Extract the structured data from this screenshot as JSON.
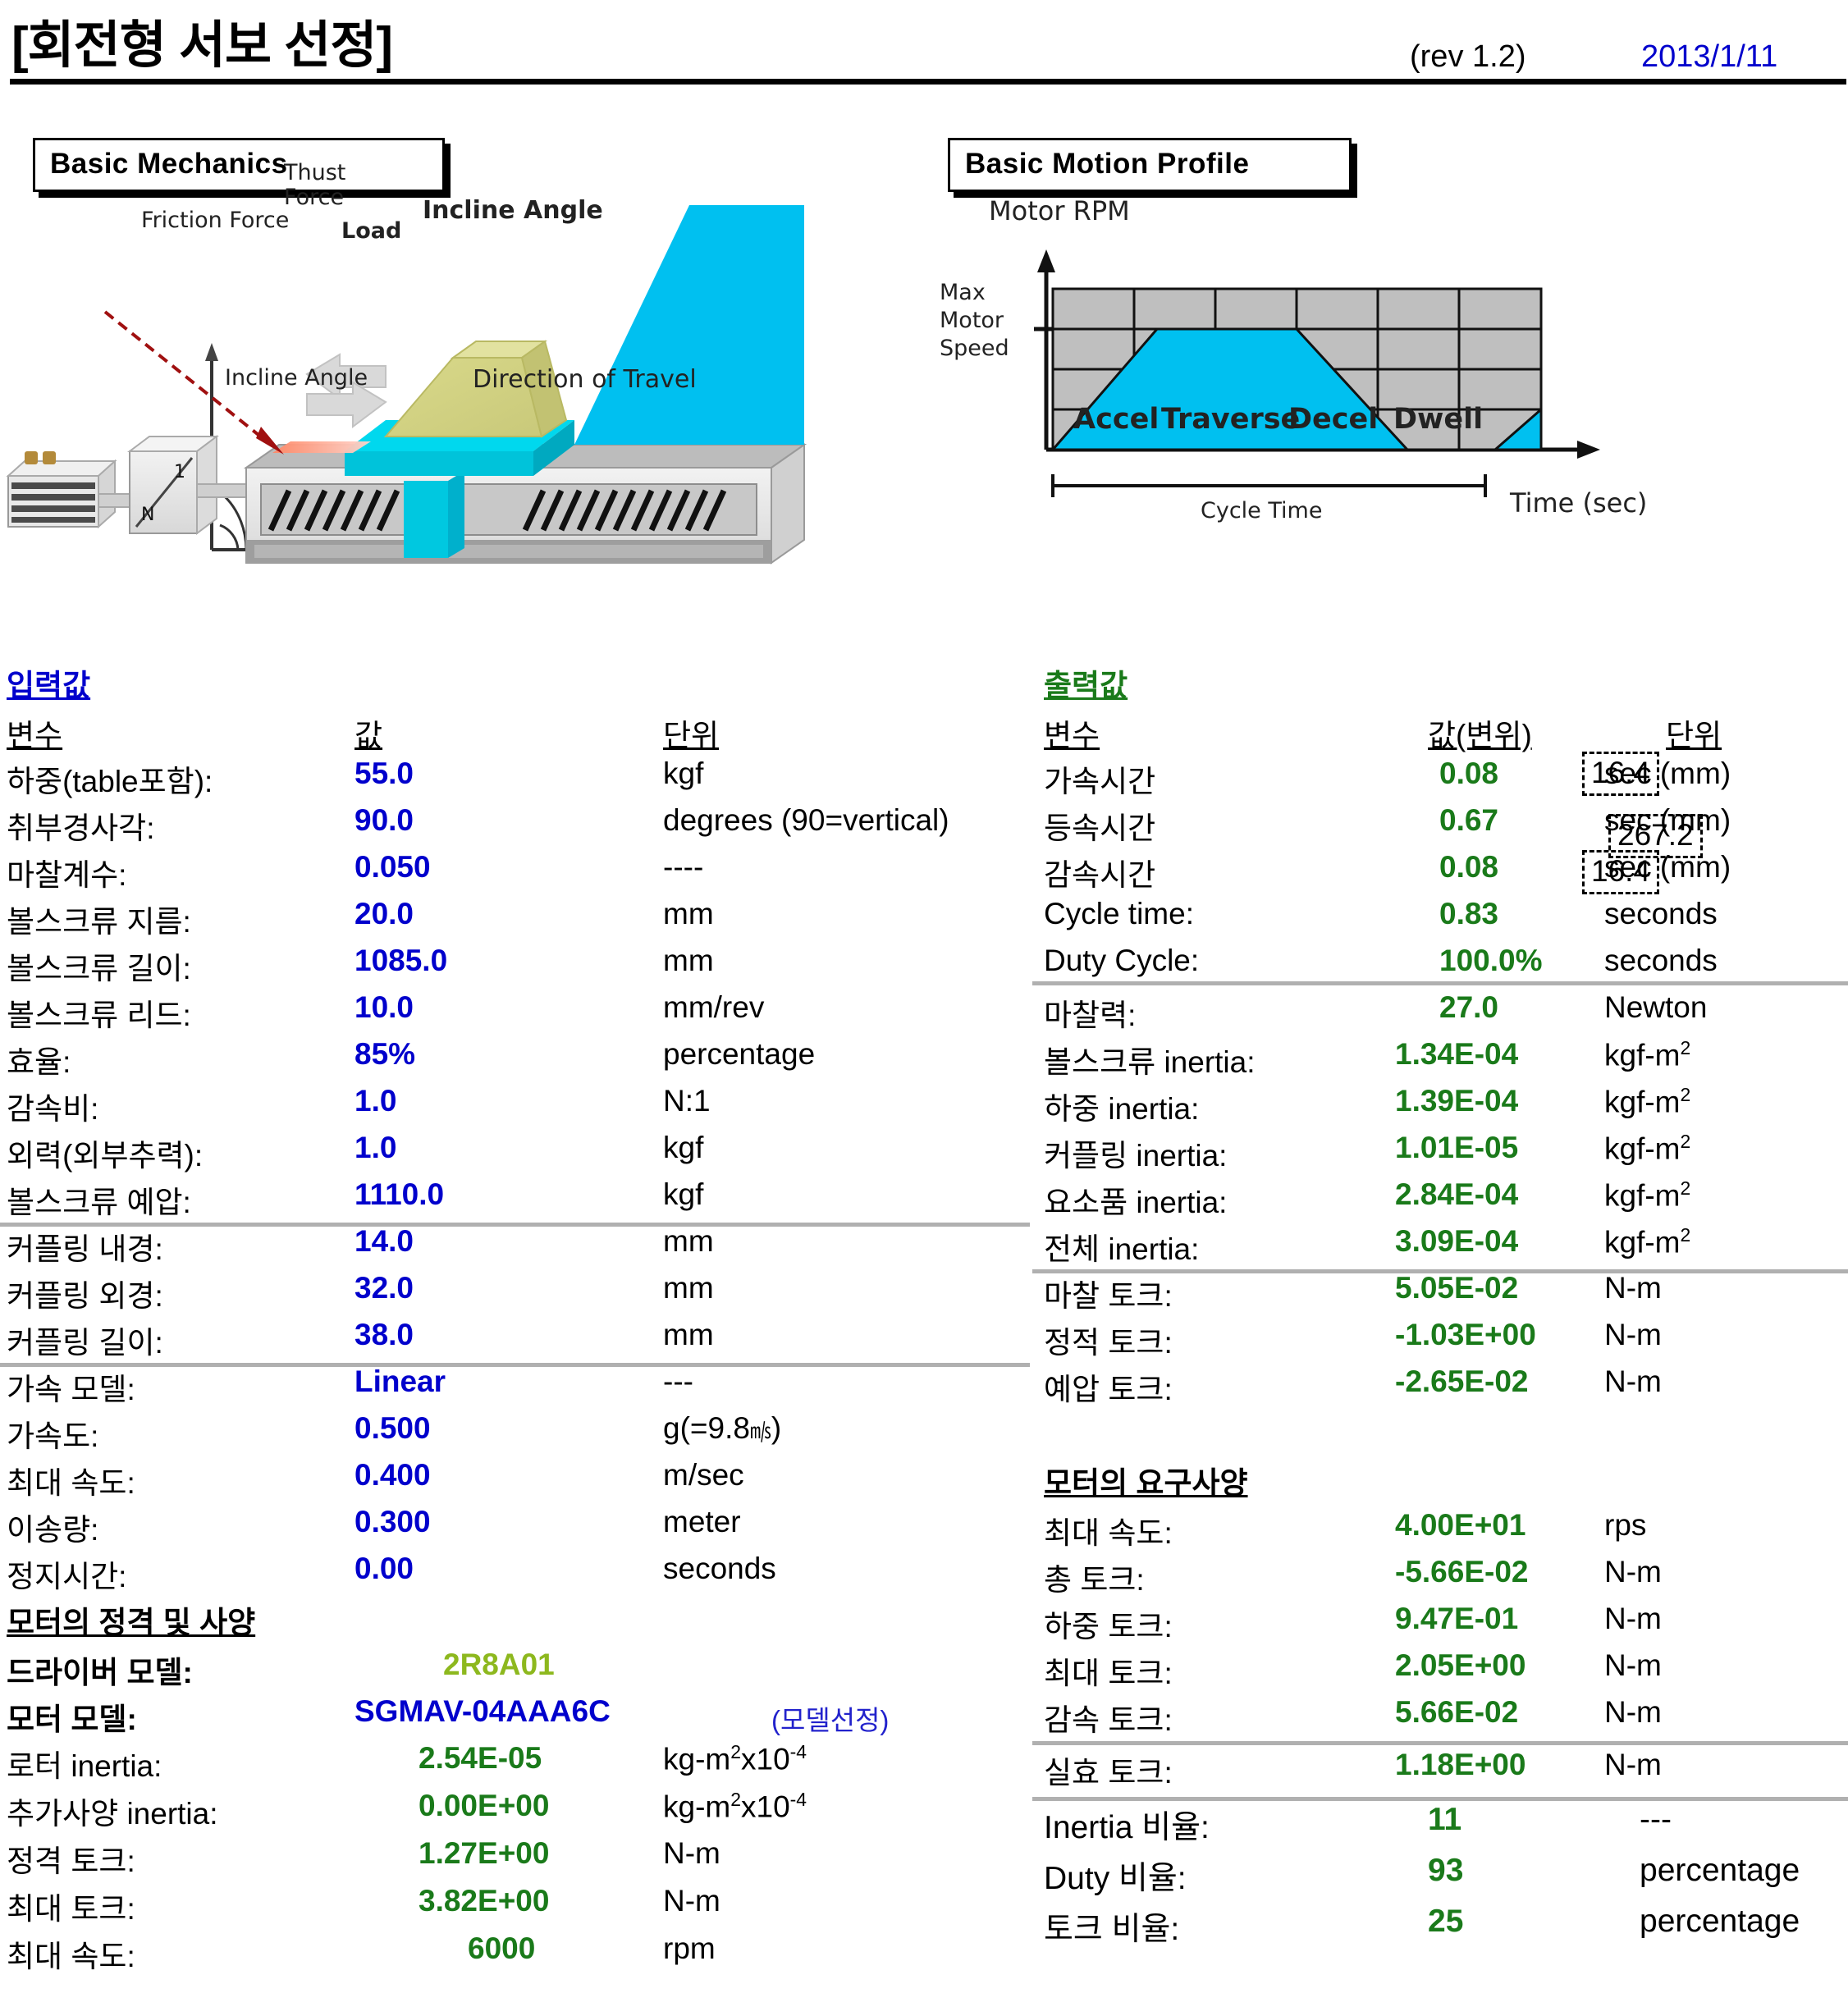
{
  "header": {
    "title": "[회전형 서보 선정]",
    "revision": "(rev 1.2)",
    "date": "2013/1/11"
  },
  "panels": {
    "mechanics_title": "Basic Mechanics",
    "motion_title": "Basic Motion Profile"
  },
  "mechanics_diagram": {
    "labels": {
      "thrust_force": "Thust\nForce",
      "thrust_force_l1": "Thust",
      "thrust_force_l2": "Force",
      "friction_force": "Friction Force",
      "load": "Load",
      "incline_angle_top": "Incline Angle",
      "incline_angle_bottom": "Incline Angle",
      "direction_of_travel": "Direction of Travel",
      "gear_n": "N",
      "gear_1": "1"
    }
  },
  "chart_data": {
    "type": "area",
    "title": "Basic Motion Profile",
    "xlabel": "Time (sec)",
    "ylabel": "Motor RPM",
    "y_tick_label": "Max\nMotor\nSpeed",
    "y_tick_l1": "Max",
    "y_tick_l2": "Motor",
    "y_tick_l3": "Speed",
    "span_label": "Cycle Time",
    "segments": [
      {
        "name": "Accel",
        "t_start": 0.0,
        "t_end": 0.22,
        "rpm_start": 0.0,
        "rpm_end": 1.0
      },
      {
        "name": "Traverse",
        "t_start": 0.22,
        "t_end": 0.5,
        "rpm_start": 1.0,
        "rpm_end": 1.0
      },
      {
        "name": "Decel",
        "t_start": 0.5,
        "t_end": 0.73,
        "rpm_start": 1.0,
        "rpm_end": 0.0
      },
      {
        "name": "Dwell",
        "t_start": 0.73,
        "t_end": 0.88,
        "rpm_start": 0.0,
        "rpm_end": 0.0
      }
    ],
    "x": [
      0.0,
      0.22,
      0.5,
      0.73,
      0.88,
      0.91,
      1.0
    ],
    "y": [
      0.0,
      1.0,
      1.0,
      0.0,
      0.0,
      0.0,
      0.33
    ],
    "ylim": [
      0,
      1.33
    ],
    "xlim": [
      0,
      1.05
    ],
    "grid": true,
    "grid_fill": "#bfbfbf",
    "series_fill": "#00c0f0",
    "legend": "none"
  },
  "input_section": {
    "heading": "입력값",
    "columns": [
      "변수",
      "값",
      "단위"
    ],
    "rows": [
      {
        "label": "하중(table포함):",
        "value": "55.0",
        "unit": "kgf"
      },
      {
        "label": "취부경사각:",
        "value": "90.0",
        "unit": "degrees (90=vertical)"
      },
      {
        "label": "마찰계수:",
        "value": "0.050",
        "unit": "----"
      },
      {
        "label": "볼스크류 지름:",
        "value": "20.0",
        "unit": "mm"
      },
      {
        "label": "볼스크류 길이:",
        "value": "1085.0",
        "unit": "mm"
      },
      {
        "label": "볼스크류 리드:",
        "value": "10.0",
        "unit": "mm/rev"
      },
      {
        "label": "효율:",
        "value": "85%",
        "unit": "percentage"
      },
      {
        "label": "감속비:",
        "value": "1.0",
        "unit": "N:1"
      },
      {
        "label": "외력(외부추력):",
        "value": "1.0",
        "unit": "kgf"
      },
      {
        "label": "볼스크류 예압:",
        "value": "1110.0",
        "unit": "kgf"
      },
      {
        "label": "커플링 내경:",
        "value": "14.0",
        "unit": "mm"
      },
      {
        "label": "커플링 외경:",
        "value": "32.0",
        "unit": "mm"
      },
      {
        "label": "커플링 길이:",
        "value": "38.0",
        "unit": "mm"
      },
      {
        "label": "가속 모델:",
        "value": "Linear",
        "unit": "---"
      },
      {
        "label": "가속도:",
        "value": "0.500",
        "unit": "g(=9.8㎧)"
      },
      {
        "label": "최대 속도:",
        "value": "0.400",
        "unit": "m/sec"
      },
      {
        "label": "이송량:",
        "value": "0.300",
        "unit": "meter"
      },
      {
        "label": "정지시간:",
        "value": "0.00",
        "unit": "seconds"
      }
    ]
  },
  "motor_spec_section": {
    "heading": "모터의 정격 및 사양",
    "driver_model_label": "드라이버 모델:",
    "driver_model_value": "2R8A01",
    "motor_model_label": "모터 모델:",
    "motor_model_value": "SGMAV-04AAA6C",
    "motor_model_note": "(모델선정)",
    "rows": [
      {
        "label": "로터 inertia:",
        "value": "2.54E-05",
        "unit_base": "kg-m",
        "unit_sup": "2",
        "unit_tail": "x10",
        "unit_exp": "-4"
      },
      {
        "label": "추가사양 inertia:",
        "value": "0.00E+00",
        "unit_base": "kg-m",
        "unit_sup": "2",
        "unit_tail": "x10",
        "unit_exp": "-4"
      },
      {
        "label": "정격 토크:",
        "value": "1.27E+00",
        "unit_base": "N-m",
        "unit_sup": "",
        "unit_tail": "",
        "unit_exp": ""
      },
      {
        "label": "최대 토크:",
        "value": "3.82E+00",
        "unit_base": "N-m",
        "unit_sup": "",
        "unit_tail": "",
        "unit_exp": ""
      },
      {
        "label": "최대 속도:",
        "value": "6000",
        "unit_base": "rpm",
        "unit_sup": "",
        "unit_tail": "",
        "unit_exp": ""
      }
    ]
  },
  "output_section": {
    "heading": "출력값",
    "columns": [
      "변수",
      "값(변위)",
      "단위"
    ],
    "rows": [
      {
        "label": "가속시간",
        "value": "0.08",
        "unit": "sec (mm)"
      },
      {
        "label": "등속시간",
        "value": "0.67",
        "unit": "sec (mm)"
      },
      {
        "label": "감속시간",
        "value": "0.08",
        "unit": "sec (mm)"
      },
      {
        "label": "Cycle time:",
        "value": "0.83",
        "unit": "seconds"
      },
      {
        "label": "Duty Cycle:",
        "value": "100.0%",
        "unit": "seconds"
      },
      {
        "label": "마찰력:",
        "value": "27.0",
        "unit": "Newton"
      },
      {
        "label": "볼스크류 inertia:",
        "value": "1.34E-04",
        "unit_base": "kgf-m",
        "unit_sup": "2"
      },
      {
        "label": "하중 inertia:",
        "value": "1.39E-04",
        "unit_base": "kgf-m",
        "unit_sup": "2"
      },
      {
        "label": "커플링 inertia:",
        "value": "1.01E-05",
        "unit_base": "kgf-m",
        "unit_sup": "2"
      },
      {
        "label": "요소품 inertia:",
        "value": "2.84E-04",
        "unit_base": "kgf-m",
        "unit_sup": "2"
      },
      {
        "label": "전체 inertia:",
        "value": "3.09E-04",
        "unit_base": "kgf-m",
        "unit_sup": "2"
      },
      {
        "label": "마찰 토크:",
        "value": "5.05E-02",
        "unit": "N-m"
      },
      {
        "label": "정적 토크:",
        "value": "-1.03E+00",
        "unit": "N-m"
      },
      {
        "label": "예압 토크:",
        "value": "-2.65E-02",
        "unit": "N-m"
      }
    ],
    "displacement_boxes": [
      {
        "value": "16.4"
      },
      {
        "value": "267.2"
      },
      {
        "value": "16.4"
      }
    ]
  },
  "motor_req_section": {
    "heading": "모터의 요구사양",
    "rows": [
      {
        "label": "최대 속도:",
        "value": "4.00E+01",
        "unit": "rps"
      },
      {
        "label": "총 토크:",
        "value": "-5.66E-02",
        "unit": "N-m"
      },
      {
        "label": "하중 토크:",
        "value": "9.47E-01",
        "unit": "N-m"
      },
      {
        "label": "최대 토크:",
        "value": "2.05E+00",
        "unit": "N-m"
      },
      {
        "label": "감속 토크:",
        "value": "5.66E-02",
        "unit": "N-m"
      },
      {
        "label": "실효 토크:",
        "value": "1.18E+00",
        "unit": "N-m"
      },
      {
        "label": "Inertia 비율:",
        "value": "11",
        "unit": "---"
      },
      {
        "label": "Duty 비율:",
        "value": "93",
        "unit": "percentage"
      },
      {
        "label": "토크 비율:",
        "value": "25",
        "unit": "percentage"
      }
    ]
  },
  "colors": {
    "input_value": "#0000CC",
    "output_value": "#1A7A1A",
    "driver_value": "#8DB81E",
    "date": "#0000CC",
    "chart_fill": "#00C0F0",
    "chart_grid_bg": "#BFBFBF",
    "rule": "#B0B0B0"
  }
}
